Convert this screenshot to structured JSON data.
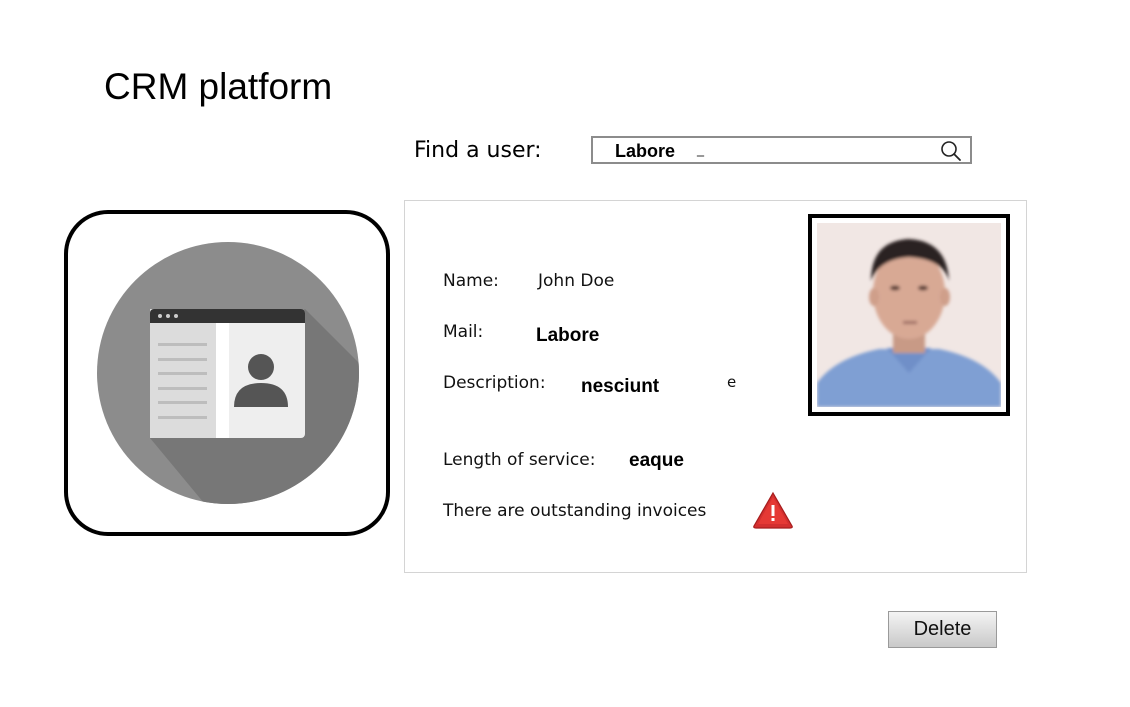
{
  "app": {
    "title": "CRM platform"
  },
  "search": {
    "label": "Find a user:",
    "value": "Labore",
    "cursor": "_",
    "icon": "search-icon"
  },
  "profile_icon": {
    "icon": "user-profile-card-icon",
    "colors": {
      "circle": "#8c8c8c",
      "shadow": "#777777",
      "card": "#eeeeee",
      "card_header": "#333333",
      "avatar": "#555555"
    }
  },
  "user": {
    "name_label": "Name:",
    "name_value": "John Doe",
    "mail_label": "Mail:",
    "mail_value": "Labore",
    "description_label": "Description:",
    "description_value": "nesciunt",
    "description_trailing": "e",
    "service_label": "Length of service:",
    "service_value": "eaque",
    "invoice_notice": "There are outstanding invoices",
    "warning_icon": "warning-triangle-icon",
    "warning_color": "#d32f2f"
  },
  "actions": {
    "delete_label": "Delete"
  }
}
